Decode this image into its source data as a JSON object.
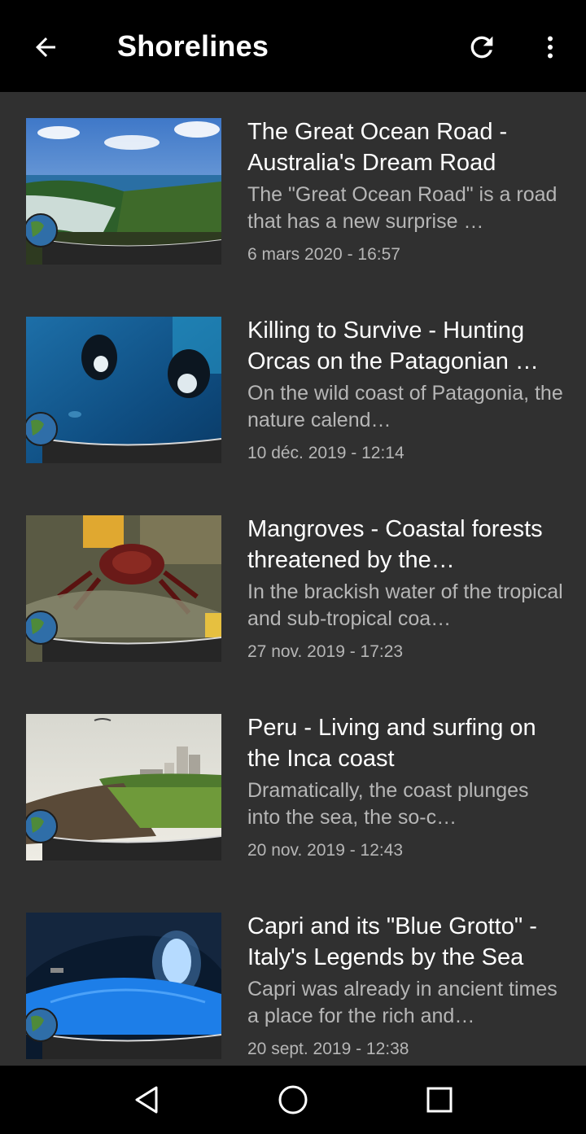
{
  "appbar": {
    "title": "Shorelines",
    "back_icon": "arrow-back-icon",
    "refresh_icon": "refresh-icon",
    "more_icon": "more-vert-icon"
  },
  "items": [
    {
      "title": "The Great Ocean Road - Australia's Dream Road",
      "description": "The \"Great Ocean Road\" is a road that has a new surprise …",
      "date": "6 mars 2020 - 16:57"
    },
    {
      "title": "Killing to Survive - Hunting Orcas on the Patagonian …",
      "description": "On the wild coast of Patagonia, the nature calend…",
      "date": "10 déc. 2019 - 12:14"
    },
    {
      "title": "Mangroves - Coastal forests threatened by the…",
      "description": "In the brackish water of the tropical and sub-tropical coa…",
      "date": "27 nov. 2019 - 17:23"
    },
    {
      "title": "Peru - Living and surfing on the Inca coast",
      "description": "Dramatically, the coast plunges into the sea, the so-c…",
      "date": "20 nov. 2019 - 12:43"
    },
    {
      "title": "Capri and its \"Blue Grotto\" - Italy's Legends by the Sea",
      "description": "Capri was already in ancient times a place for the rich and…",
      "date": "20 sept. 2019 - 12:38"
    }
  ],
  "navbar": {
    "back_icon": "nav-back-icon",
    "home_icon": "nav-home-icon",
    "recents_icon": "nav-recents-icon"
  },
  "colors": {
    "appbar_bg": "#000000",
    "list_bg": "#303030",
    "primary_text": "#ffffff",
    "secondary_text": "#b6b6b6"
  }
}
